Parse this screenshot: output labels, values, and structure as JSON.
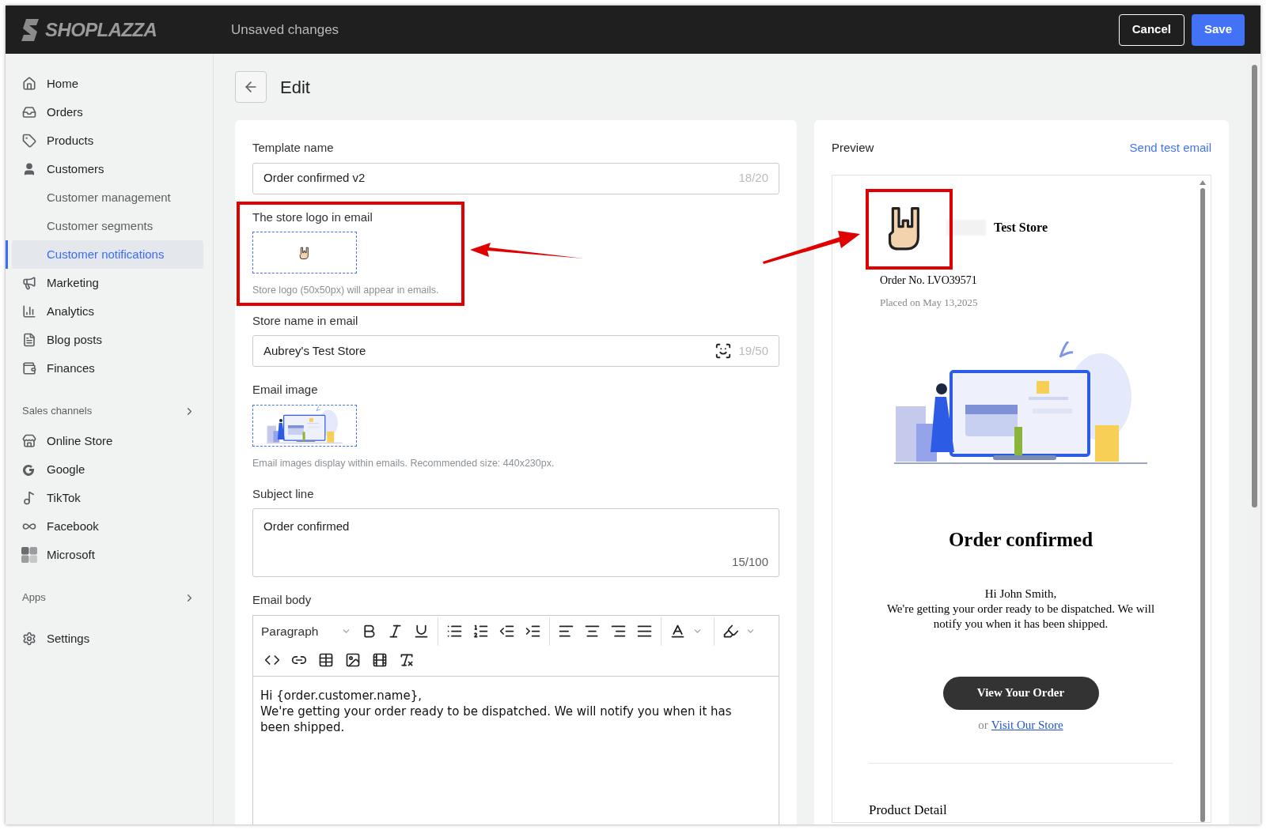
{
  "topbar": {
    "logo": "SHOPLAZZA",
    "status": "Unsaved changes",
    "buttons": [
      {
        "label": "Cancel",
        "kind": "secondary"
      },
      {
        "label": "Save",
        "kind": "primary"
      }
    ]
  },
  "sidebar": {
    "main": [
      {
        "label": "Home",
        "selected": false
      },
      {
        "label": "Orders",
        "selected": false
      },
      {
        "label": "Products",
        "selected": false
      },
      {
        "label": "Customers",
        "selected": false,
        "children": [
          {
            "label": "Customer management",
            "selected": false
          },
          {
            "label": "Customer segments",
            "selected": false
          },
          {
            "label": "Customer notifications",
            "selected": true
          }
        ]
      },
      {
        "label": "Marketing",
        "selected": false
      },
      {
        "label": "Analytics",
        "selected": false
      },
      {
        "label": "Blog posts",
        "selected": false
      },
      {
        "label": "Finances",
        "selected": false
      }
    ],
    "sections": [
      {
        "title": "Sales channels",
        "items": [
          {
            "label": "Online Store",
            "selected": false
          },
          {
            "label": "Google",
            "selected": false
          },
          {
            "label": "TikTok",
            "selected": false
          },
          {
            "label": "Facebook",
            "selected": false
          },
          {
            "label": "Microsoft",
            "selected": false
          }
        ]
      },
      {
        "title": "Apps"
      }
    ],
    "footer": [
      {
        "label": "Settings",
        "selected": false
      }
    ]
  },
  "page": {
    "title": "Edit"
  },
  "form": {
    "fields": [
      {
        "kind": "text",
        "label": "Template name",
        "value": "Order confirmed v2",
        "counter": "18/20"
      },
      {
        "kind": "logo",
        "label": "The store logo in email",
        "hint": "Store logo (50x50px) will appear in emails."
      },
      {
        "kind": "text",
        "label": "Store name in email",
        "value": "Aubrey's Test Store",
        "counter": "19/50",
        "scan": true
      },
      {
        "kind": "image",
        "label": "Email image",
        "hint": "Email images display within emails. Recommended size: 440x230px."
      },
      {
        "kind": "textarea",
        "label": "Subject line",
        "value": "Order confirmed",
        "counter": "15/100"
      }
    ],
    "editor": {
      "label": "Email body",
      "block_format": "Paragraph",
      "body": [
        "Hi {order.customer.name},",
        "We're getting your order ready to be dispatched. We will notify you when it has been shipped."
      ]
    }
  },
  "preview": {
    "title": "Preview",
    "link": "Send test email",
    "email": {
      "store_name": "Test Store",
      "order_no": "Order No. LVO39571",
      "placed": "Placed on May 13,2025",
      "heading": "Order confirmed",
      "greeting": "Hi John Smith,",
      "message": "We're getting your order ready to be dispatched. We will notify you when it has been shipped.",
      "button": "View Your Order",
      "or_text": "or",
      "store_link": "Visit Our Store",
      "section": "Product Detail"
    }
  }
}
